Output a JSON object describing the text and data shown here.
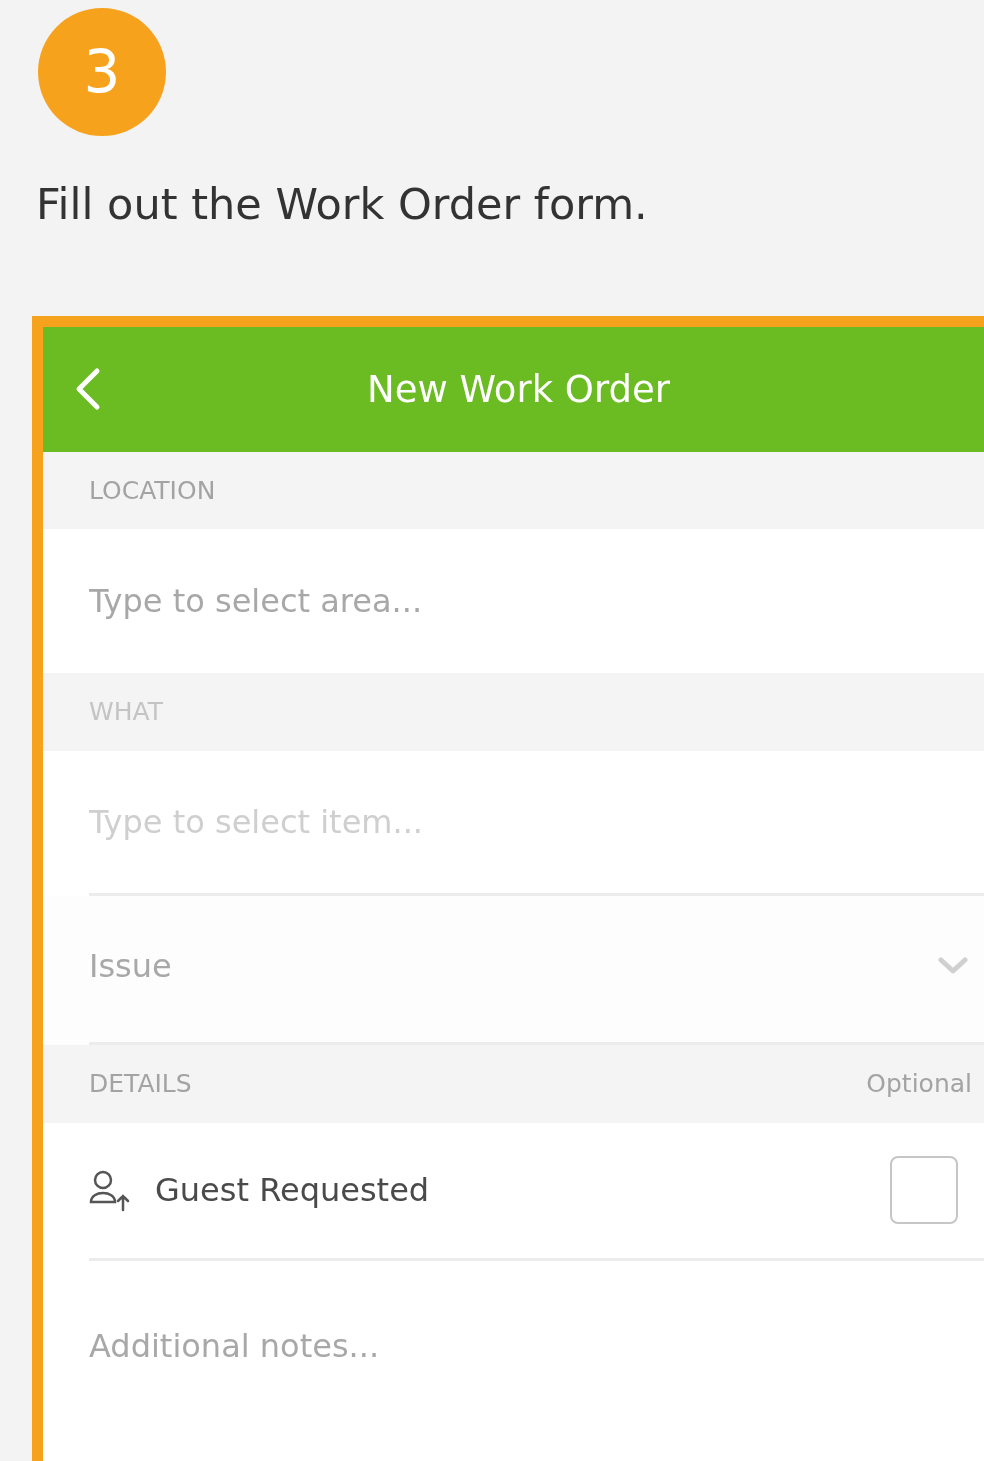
{
  "step": {
    "number": "3"
  },
  "instruction": "Fill out the Work Order form.",
  "screen": {
    "header": {
      "title": "New Work Order"
    },
    "sections": [
      {
        "label": "LOCATION",
        "rows": [
          {
            "kind": "text",
            "placeholder": "Type to select area...",
            "disabled": false
          }
        ]
      },
      {
        "label": "WHAT",
        "disabled": true,
        "rows": [
          {
            "kind": "text",
            "placeholder": "Type to select item...",
            "disabled": true
          },
          {
            "kind": "select",
            "placeholder": "Issue"
          }
        ]
      },
      {
        "label": "DETAILS",
        "note": "Optional",
        "rows": [
          {
            "kind": "checkbox",
            "label": "Guest Requested",
            "checked": false
          },
          {
            "kind": "notes",
            "placeholder": "Additional notes..."
          }
        ]
      }
    ]
  }
}
